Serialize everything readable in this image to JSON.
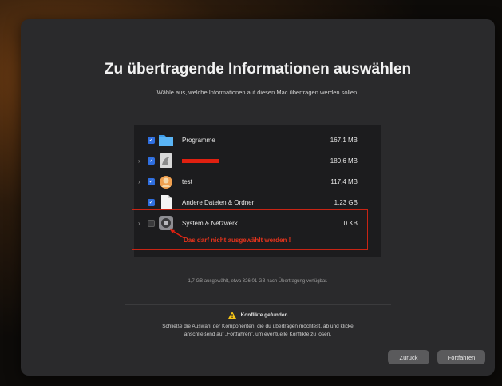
{
  "window": {
    "title": "Zu übertragende Informationen auswählen",
    "subtitle": "Wähle aus, welche Informationen auf diesen Mac übertragen werden sollen."
  },
  "items": [
    {
      "label": "Programme",
      "size": "167,1 MB",
      "checked": true,
      "expandable": false,
      "icon": "folder-icon"
    },
    {
      "label": "",
      "size": "180,6 MB",
      "checked": true,
      "expandable": true,
      "icon": "user-icon",
      "redacted": true
    },
    {
      "label": "test",
      "size": "117,4 MB",
      "checked": true,
      "expandable": true,
      "icon": "user-icon"
    },
    {
      "label": "Andere Dateien & Ordner",
      "size": "1,23 GB",
      "checked": true,
      "expandable": false,
      "icon": "document-icon"
    },
    {
      "label": "System & Netzwerk",
      "size": "0 KB",
      "checked": false,
      "expandable": true,
      "icon": "system-settings-icon"
    }
  ],
  "annotation": {
    "text": "Das darf nicht ausgewählt werden !",
    "color": "#e8341c"
  },
  "summary": "1,7 GB ausgewählt, etwa 326,01 GB nach Übertragung verfügbar.",
  "conflicts": {
    "title": "Konflikte gefunden",
    "line1": "Schließe die Auswahl der Komponenten, die du übertragen möchtest, ab und klicke",
    "line2": "anschließend auf „Fortfahren\", um eventuelle Konflikte zu lösen."
  },
  "buttons": {
    "back": "Zurück",
    "continue": "Fortfahren"
  },
  "colors": {
    "accent": "#2f6fe0",
    "warning": "#c82414"
  }
}
